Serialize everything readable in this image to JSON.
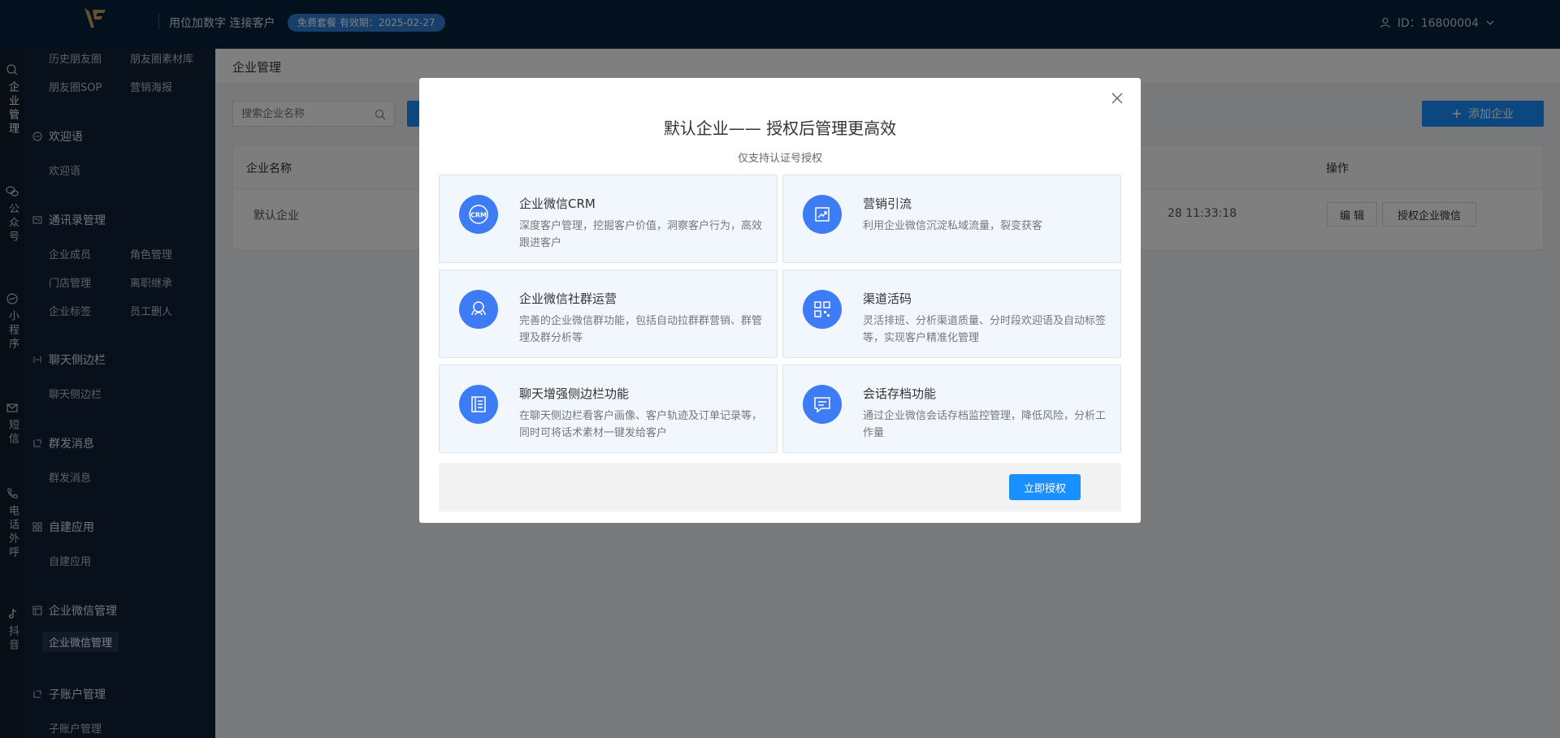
{
  "header": {
    "slogan": "用位加数字 连接客户",
    "plan_badge": "免费套餐 有效期：2025-02-27",
    "user_id": "ID：16800004"
  },
  "icon_strip": [
    {
      "icon": "chat-search-icon",
      "label": "企业管理"
    },
    {
      "icon": "wechat-icon",
      "label": "公众号"
    },
    {
      "icon": "mini-program-icon",
      "label": "小程序"
    },
    {
      "icon": "mail-icon",
      "label": "短信"
    },
    {
      "icon": "phone-icon",
      "label": "电话外呼"
    },
    {
      "icon": "tiktok-icon",
      "label": "抖音"
    }
  ],
  "sidebar": {
    "top_items": [
      "历史朋友圈",
      "朋友圈素材库",
      "朋友圈SOP",
      "营销海报"
    ],
    "groups": [
      {
        "title": "欢迎语",
        "icon": "message-icon",
        "items": [
          "欢迎语"
        ]
      },
      {
        "title": "通讯录管理",
        "icon": "contacts-icon",
        "items": [
          "企业成员",
          "角色管理",
          "门店管理",
          "离职继承",
          "企业标签",
          "员工删人"
        ]
      },
      {
        "title": "聊天侧边栏",
        "icon": "sidebar-icon",
        "items": [
          "聊天侧边栏"
        ]
      },
      {
        "title": "群发消息",
        "icon": "broadcast-icon",
        "items": [
          "群发消息"
        ]
      },
      {
        "title": "自建应用",
        "icon": "apps-icon",
        "items": [
          "自建应用"
        ]
      },
      {
        "title": "企业微信管理",
        "icon": "enterprise-icon",
        "items": [
          "企业微信管理"
        ]
      },
      {
        "title": "子账户管理",
        "icon": "subaccount-icon",
        "items": [
          "子账户管理"
        ]
      }
    ]
  },
  "main": {
    "page_title": "企业管理",
    "search_placeholder": "搜索企业名称",
    "add_button": "添加企业",
    "table": {
      "columns": [
        "企业名称",
        "操作"
      ],
      "rows": [
        {
          "name": "默认企业",
          "time": "28 11:33:18",
          "actions": [
            "编 辑",
            "授权企业微信"
          ]
        }
      ]
    }
  },
  "modal": {
    "title": "默认企业—— 授权后管理更高效",
    "subtitle": "仅支持认证号授权",
    "features": [
      {
        "title": "企业微信CRM",
        "desc": "深度客户管理，挖掘客户价值，洞察客户行为，高效跟进客户",
        "icon": "crm-icon",
        "icon_text": "CRM"
      },
      {
        "title": "营销引流",
        "desc": "利用企业微信沉淀私域流量，裂变获客",
        "icon": "growth-chart-icon"
      },
      {
        "title": "企业微信社群运营",
        "desc": "完善的企业微信群功能，包括自动拉群群营销、群管理及群分析等",
        "icon": "community-icon"
      },
      {
        "title": "渠道活码",
        "desc": "灵活排班、分析渠道质量、分时段欢迎语及自动标签等，实现客户精准化管理",
        "icon": "qrcode-icon"
      },
      {
        "title": "聊天增强侧边栏功能",
        "desc": "在聊天侧边栏看客户画像、客户轨迹及订单记录等，同时可将话术素材一键发给客户",
        "icon": "book-icon"
      },
      {
        "title": "会话存档功能",
        "desc": "通过企业微信会话存档监控管理，降低风险，分析工作量",
        "icon": "chat-bubble-icon"
      }
    ],
    "authorize_button": "立即授权"
  },
  "colors": {
    "header_bg": "#06203c",
    "sidebar_bg": "#0f2136",
    "primary": "#1890ff",
    "feature_icon": "#3d7cf5"
  }
}
